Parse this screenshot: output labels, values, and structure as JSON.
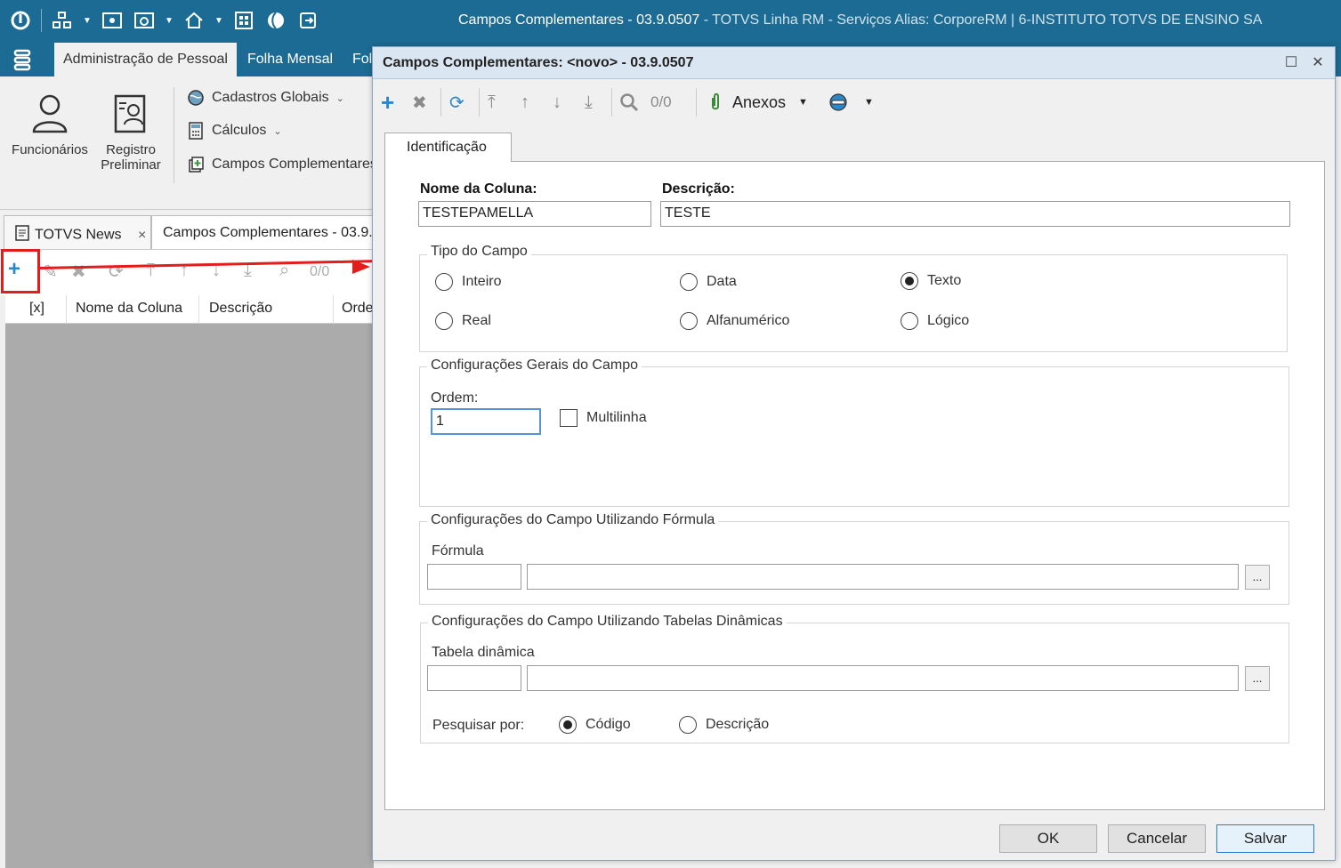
{
  "window": {
    "title_main": "Campos Complementares - 03.9.0507",
    "title_rest": " - TOTVS Linha RM - Serviços  Alias: CorporeRM | 6-INSTITUTO TOTVS DE ENSINO SA"
  },
  "menu": {
    "tabs": [
      "Administração de Pessoal",
      "Folha Mensal",
      "Fol"
    ]
  },
  "ribbon": {
    "funcionarios": "Funcionários",
    "registro_line1": "Registro",
    "registro_line2": "Preliminar",
    "cadastros_globais": "Cadastros Globais",
    "calculos": "Cálculos",
    "campos_complementares": "Campos Complementares"
  },
  "doc_tabs": {
    "news": "TOTVS News",
    "close": "×",
    "campos": "Campos Complementares - 03.9."
  },
  "bg_toolbar": {
    "counter": "0/0"
  },
  "grid": {
    "columns": [
      "[x]",
      "Nome da Coluna",
      "Descrição",
      "Orde"
    ]
  },
  "dialog": {
    "title": "Campos Complementares: <novo> - 03.9.0507",
    "toolbar": {
      "counter": "0/0",
      "anexos": "Anexos"
    },
    "tab": "Identificação",
    "nome_label": "Nome da Coluna:",
    "nome_value": "TESTEPAMELLA",
    "desc_label": "Descrição:",
    "desc_value": "TESTE",
    "tipo": {
      "title": "Tipo do Campo",
      "options": [
        "Inteiro",
        "Data",
        "Texto",
        "Real",
        "Alfanumérico",
        "Lógico"
      ],
      "selected": "Texto"
    },
    "config_gerais": {
      "title": "Configurações Gerais do Campo",
      "ordem_label": "Ordem:",
      "ordem_value": "1",
      "multilinha": "Multilinha"
    },
    "formula": {
      "title": "Configurações do Campo Utilizando Fórmula",
      "label": "Fórmula",
      "button": "..."
    },
    "tabela": {
      "title": "Configurações do Campo Utilizando Tabelas Dinâmicas",
      "label": "Tabela dinâmica",
      "button": "...",
      "pesquisar_label": "Pesquisar por:",
      "options": [
        "Código",
        "Descrição"
      ],
      "selected": "Código"
    },
    "buttons": {
      "ok": "OK",
      "cancel": "Cancelar",
      "save": "Salvar"
    }
  },
  "colors": {
    "titlebar": "#1c6b94",
    "highlight": "#e31c1c",
    "accent": "#2b87c8"
  }
}
